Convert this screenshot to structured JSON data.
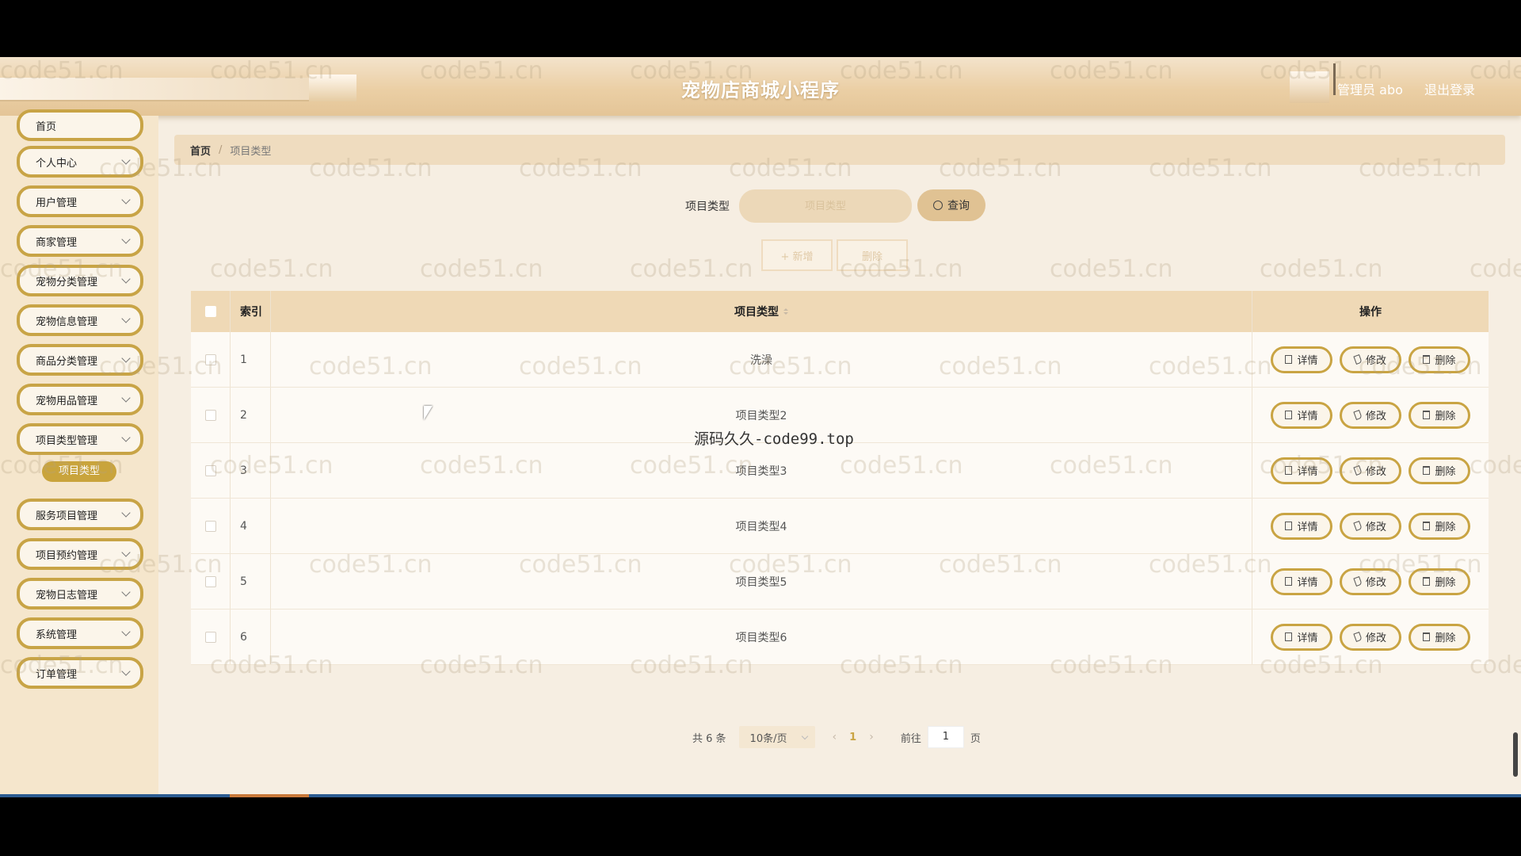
{
  "header": {
    "title": "宠物店商城小程序",
    "user": "管理员 abo",
    "logout": "退出登录"
  },
  "sidebar": {
    "items": [
      {
        "label": "首页"
      },
      {
        "label": "个人中心"
      },
      {
        "label": "用户管理"
      },
      {
        "label": "商家管理"
      },
      {
        "label": "宠物分类管理"
      },
      {
        "label": "宠物信息管理"
      },
      {
        "label": "商品分类管理"
      },
      {
        "label": "宠物用品管理"
      },
      {
        "label": "项目类型管理"
      },
      {
        "label": "服务项目管理"
      },
      {
        "label": "项目预约管理"
      },
      {
        "label": "宠物日志管理"
      },
      {
        "label": "系统管理"
      },
      {
        "label": "订单管理"
      }
    ],
    "active_sub": "项目类型"
  },
  "breadcrumb": {
    "home": "首页",
    "current": "项目类型"
  },
  "search": {
    "label": "项目类型",
    "placeholder": "项目类型",
    "button": "查询"
  },
  "actions": {
    "add": "+ 新增",
    "delete": "删除"
  },
  "table": {
    "headers": {
      "index": "索引",
      "type": "项目类型",
      "ops": "操作"
    },
    "rows": [
      {
        "index": "1",
        "type": "洗澡"
      },
      {
        "index": "2",
        "type": "项目类型2"
      },
      {
        "index": "3",
        "type": "项目类型3"
      },
      {
        "index": "4",
        "type": "项目类型4"
      },
      {
        "index": "5",
        "type": "项目类型5"
      },
      {
        "index": "6",
        "type": "项目类型6"
      }
    ],
    "op_labels": {
      "detail": "详情",
      "edit": "修改",
      "delete": "删除"
    }
  },
  "pagination": {
    "total": "共 6 条",
    "page_size": "10条/页",
    "current": "1",
    "goto_label": "前往",
    "goto_value": "1",
    "page_suffix": "页"
  },
  "overlay": {
    "watermark": "code51.cn",
    "center_text": "源码久久-code99.top"
  },
  "colors": {
    "accent": "#c9a443",
    "header": "#e4c597",
    "table_head": "#efd9b6",
    "sidebar": "#f5e6cc"
  }
}
